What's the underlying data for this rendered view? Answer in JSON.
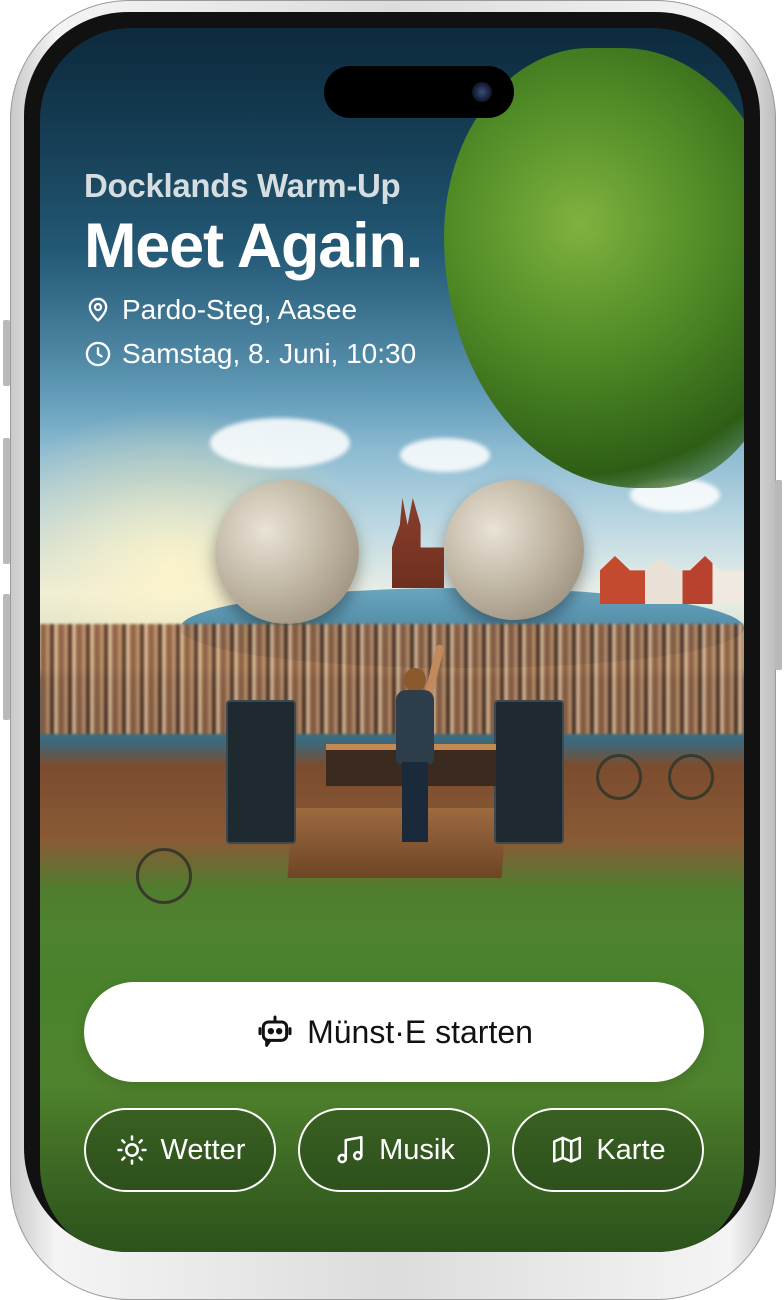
{
  "event": {
    "series": "Docklands Warm-Up",
    "title": "Meet Again.",
    "location": "Pardo-Steg, Aasee",
    "datetime": "Samstag, 8. Juni, 10:30"
  },
  "primary_action": {
    "label": "Münst·E starten",
    "icon": "robot-chat-icon"
  },
  "quick_actions": [
    {
      "label": "Wetter",
      "icon": "sun-icon"
    },
    {
      "label": "Musik",
      "icon": "music-note-icon"
    },
    {
      "label": "Karte",
      "icon": "map-icon"
    }
  ],
  "colors": {
    "button_bg": "#ffffff",
    "text_primary": "#ffffff",
    "text_subtitle": "#d6dde0"
  }
}
